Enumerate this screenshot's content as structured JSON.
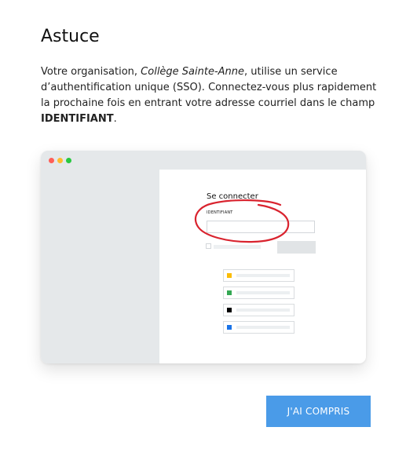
{
  "dialog": {
    "title": "Astuce",
    "body": {
      "part1": "Votre organisation, ",
      "org_name": "Collège Sainte-Anne",
      "part2": ", utilise un service d’authentification unique (SSO). Connectez-vous plus rapidement la prochaine fois en entrant votre adresse courriel dans le champ ",
      "field_name": "IDENTIFIANT",
      "part3": "."
    },
    "illustration": {
      "signin_title": "Se connecter",
      "identifier_label": "IDENTIFIANT",
      "annotation_color": "#d9232e",
      "window_dots": [
        "#ff5f57",
        "#febc2e",
        "#28c840"
      ],
      "sso_buttons": [
        {
          "icon": "yellow-square-icon",
          "color": "#fbbc05"
        },
        {
          "icon": "green-square-icon",
          "color": "#34a853"
        },
        {
          "icon": "black-square-icon",
          "color": "#000000"
        },
        {
          "icon": "blue-square-icon",
          "color": "#1a73e8"
        }
      ]
    },
    "confirm_label": "J'AI COMPRIS",
    "accent_color": "#4a9be8"
  }
}
